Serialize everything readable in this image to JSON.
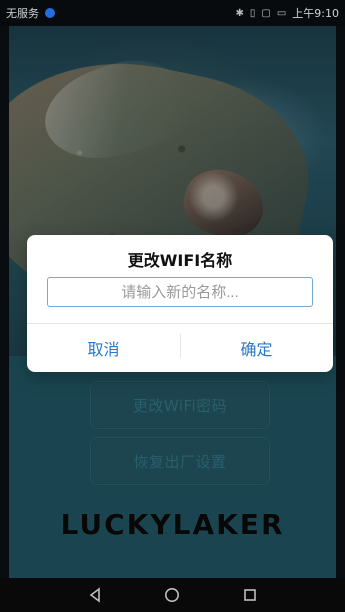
{
  "status_bar": {
    "carrier": "无服务",
    "time": "上午9:10",
    "icons": [
      "bluetooth-icon",
      "vibrate-icon",
      "nfc-icon",
      "battery-icon"
    ]
  },
  "screen": {
    "buttons": {
      "change_password": "更改WiFi密码",
      "factory_reset": "恢复出厂设置"
    },
    "brand": "LUCKYLAKER"
  },
  "dialog": {
    "title": "更改WIFI名称",
    "input_placeholder": "请输入新的名称...",
    "cancel": "取消",
    "confirm": "确定"
  },
  "nav_bar": {
    "icons": [
      "back-icon",
      "home-icon",
      "recent-apps-icon"
    ]
  }
}
